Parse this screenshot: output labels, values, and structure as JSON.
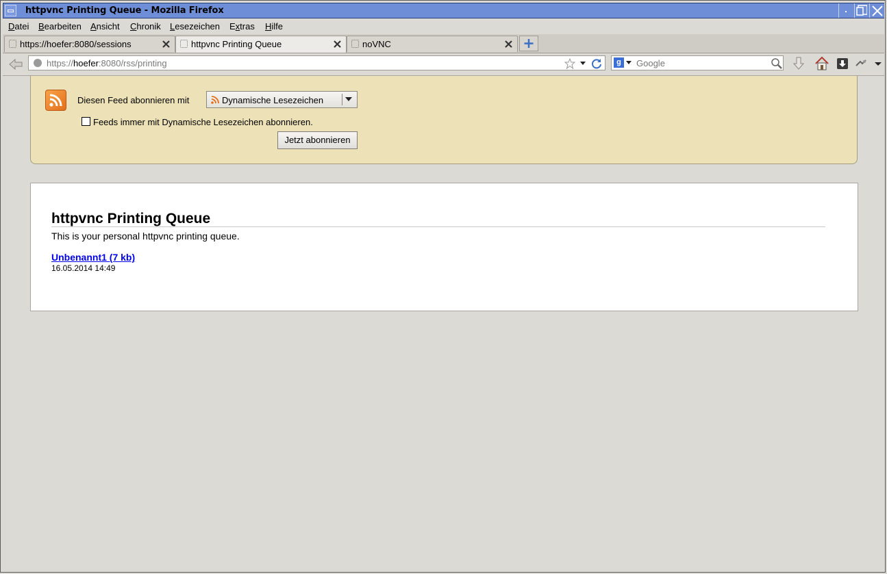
{
  "window": {
    "title": "httpvnc Printing Queue - Mozilla Firefox"
  },
  "menubar": {
    "items": [
      {
        "label": "Datei",
        "accel": "D",
        "rest": "atei"
      },
      {
        "label": "Bearbeiten",
        "accel": "B",
        "rest": "earbeiten"
      },
      {
        "label": "Ansicht",
        "accel": "A",
        "rest": "nsicht"
      },
      {
        "label": "Chronik",
        "accel": "C",
        "rest": "hronik"
      },
      {
        "label": "Lesezeichen",
        "accel": "L",
        "rest": "esezeichen"
      },
      {
        "label": "Extras",
        "pre": "E",
        "accel": "x",
        "rest": "tras"
      },
      {
        "label": "Hilfe",
        "accel": "H",
        "rest": "ilfe"
      }
    ]
  },
  "tabs": [
    {
      "label": "https://hoefer:8080/sessions",
      "active": false
    },
    {
      "label": "httpvnc Printing Queue",
      "active": true
    },
    {
      "label": "noVNC",
      "active": false
    }
  ],
  "navbar": {
    "url_prefix": "https://",
    "url_host": "hoefer",
    "url_rest": ":8080/rss/printing",
    "search_placeholder": "Google",
    "search_engine_icon": "g-icon"
  },
  "feed_subscribe": {
    "label": "Diesen Feed abonnieren mit",
    "reader": "Dynamische Lesezeichen",
    "always_label": "Feeds immer mit Dynamische Lesezeichen abonnieren.",
    "always_checked": false,
    "button": "Jetzt abonnieren"
  },
  "feed": {
    "title": "httpvnc Printing Queue",
    "subtitle": "This is your personal httpvnc printing queue.",
    "entries": [
      {
        "title": "Unbenannt1 (7 kb)",
        "date": "16.05.2014 14:49"
      }
    ]
  },
  "colors": {
    "titlebar": "#6e8ed7",
    "feed_header_bg": "#ede1b7",
    "link": "#0000ee"
  }
}
